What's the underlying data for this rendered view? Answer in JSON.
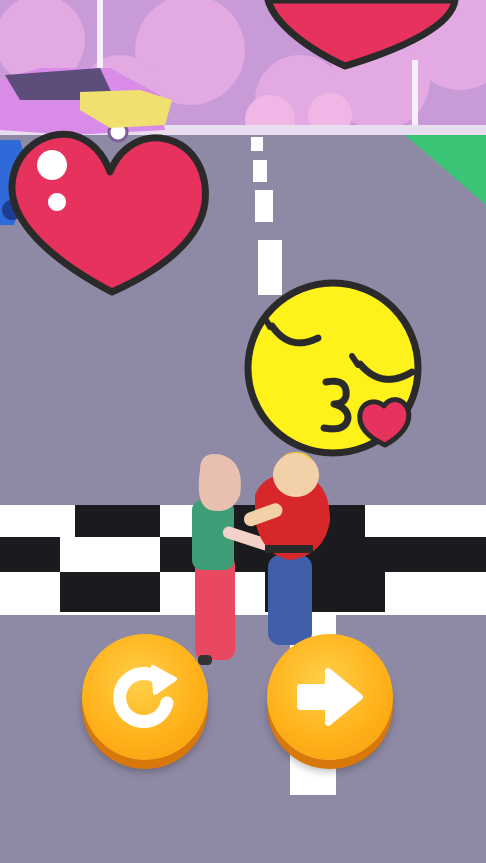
{
  "scene": {
    "name": "kiss-level-complete",
    "colors": {
      "sky": "#c99ad8",
      "road": "#8e8aa5",
      "heart": "#e8325e",
      "emoji": "#fff21a",
      "button": "#ffb21a",
      "grass": "#3cc476"
    }
  },
  "icons": {
    "reaction_emoji": "kissing-face-emoji",
    "big_heart": "heart-icon",
    "retry": "restart-arrow-icon",
    "next": "right-arrow-icon"
  },
  "controls": {
    "retry": {
      "action": "restart-level"
    },
    "next": {
      "action": "next-level"
    }
  }
}
